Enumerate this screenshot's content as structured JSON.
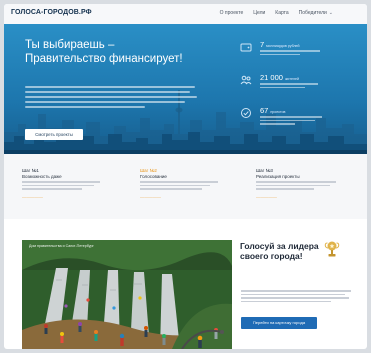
{
  "header": {
    "logo": "ГОЛОСА-ГОРОДОВ.РФ",
    "nav": [
      "О проекте",
      "Цели",
      "Карта",
      "Победители"
    ]
  },
  "hero": {
    "title_line1": "Ты выбираешь –",
    "title_line2": "Правительство финансирует!",
    "button": "Смотреть проекты"
  },
  "stats": [
    {
      "value": "7",
      "unit": "миллиардов рублей",
      "icon": "wallet-icon"
    },
    {
      "value": "21 000",
      "unit": "жителей",
      "icon": "people-icon"
    },
    {
      "value": "67",
      "unit": "проектов",
      "icon": "check-icon"
    }
  ],
  "steps": [
    {
      "title": "Шаг №1",
      "subtitle": "Возможность даже"
    },
    {
      "title": "Шаг №2",
      "subtitle": "Голосование"
    },
    {
      "title": "Шаг №3",
      "subtitle": "Реализация проекты"
    }
  ],
  "vote": {
    "photo_caption": "Дом правительства и Санкт-Петербург",
    "title": "Голосуй за лидера своего города!",
    "button": "Перейти на карточку города",
    "icon": "trophy-icon"
  },
  "colors": {
    "hero_blue": "#1d76ad",
    "accent_orange": "#e8951a",
    "button_blue": "#1f6bb5"
  }
}
